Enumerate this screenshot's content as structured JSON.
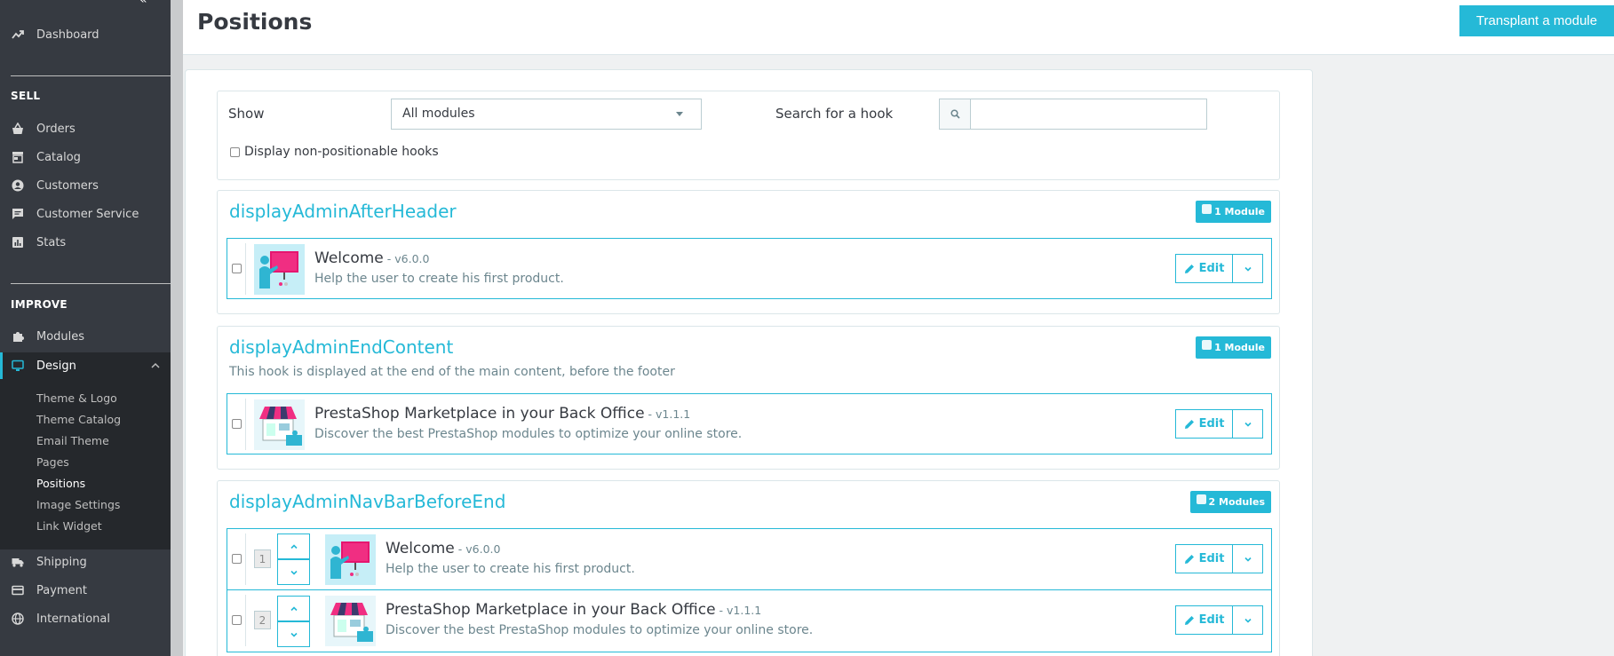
{
  "sidebar": {
    "collapse_label": "«",
    "dashboard": "Dashboard",
    "sell_title": "SELL",
    "sell_items": [
      "Orders",
      "Catalog",
      "Customers",
      "Customer Service",
      "Stats"
    ],
    "improve_title": "IMPROVE",
    "modules": "Modules",
    "design": "Design",
    "design_subitems": [
      "Theme & Logo",
      "Theme Catalog",
      "Email Theme",
      "Pages",
      "Positions",
      "Image Settings",
      "Link Widget"
    ],
    "other_items": [
      "Shipping",
      "Payment",
      "International"
    ]
  },
  "header": {
    "title": "Positions",
    "transplant_label": "Transplant a module"
  },
  "filters": {
    "show_label": "Show",
    "show_value": "All modules",
    "hook_search_label": "Search for a hook",
    "hook_search_value": "",
    "non_positionable_label": "Display non-positionable hooks"
  },
  "hooks": [
    {
      "name": "displayAdminAfterHeader",
      "badge": "1 Module",
      "modules": [
        {
          "name": "Welcome",
          "version": "- v6.0.0",
          "description": "Help the user to create his first product.",
          "edit_label": "Edit",
          "icon": "welcome-icon"
        }
      ]
    },
    {
      "name": "displayAdminEndContent",
      "badge": "1 Module",
      "description": "This hook is displayed at the end of the main content, before the footer",
      "modules": [
        {
          "name": "PrestaShop Marketplace in your Back Office",
          "version": "- v1.1.1",
          "description": "Discover the best PrestaShop modules to optimize your online store.",
          "edit_label": "Edit",
          "icon": "marketplace-icon"
        }
      ]
    },
    {
      "name": "displayAdminNavBarBeforeEnd",
      "badge": "2 Modules",
      "modules": [
        {
          "position": "1",
          "name": "Welcome",
          "version": "- v6.0.0",
          "description": "Help the user to create his first product.",
          "edit_label": "Edit",
          "icon": "welcome-icon"
        },
        {
          "position": "2",
          "name": "PrestaShop Marketplace in your Back Office",
          "version": "- v1.1.1",
          "description": "Discover the best PrestaShop modules to optimize your online store.",
          "edit_label": "Edit",
          "icon": "marketplace-icon"
        }
      ]
    }
  ],
  "colors": {
    "accent": "#25b9d7",
    "sidebar_bg": "#363a41",
    "sidebar_active": "#25282c",
    "text": "#363a41",
    "muted": "#6c868e"
  }
}
